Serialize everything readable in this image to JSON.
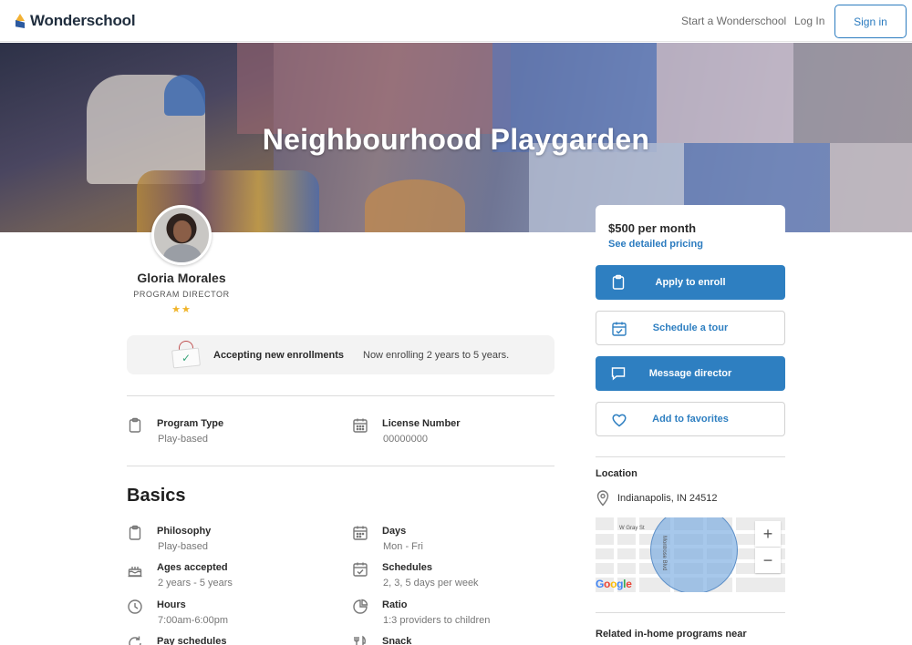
{
  "header": {
    "logo_text": "Wonderschool",
    "start_link": "Start a Wonderschool",
    "login_link": "Log In",
    "signin_button": "Sign in"
  },
  "hero": {
    "title": "Neighbourhood Playgarden"
  },
  "director": {
    "name": "Gloria Morales",
    "role": "PROGRAM DIRECTOR",
    "stars": "★★",
    "rating": 2
  },
  "enrollment": {
    "label": "Accepting new enrollments",
    "description": "Now enrolling 2 years to 5 years."
  },
  "program": {
    "type_title": "Program Type",
    "type_value": "Play-based",
    "license_title": "License Number",
    "license_value": "00000000"
  },
  "basics": {
    "heading": "Basics",
    "items": [
      {
        "title": "Philosophy",
        "value": "Play-based",
        "icon": "clipboard-icon"
      },
      {
        "title": "Days",
        "value": "Mon - Fri",
        "icon": "calendar-icon"
      },
      {
        "title": "Ages accepted",
        "value": "2 years - 5 years",
        "icon": "cake-icon"
      },
      {
        "title": "Schedules",
        "value": "2, 3, 5 days per week",
        "icon": "calendar-check-icon"
      },
      {
        "title": "Hours",
        "value": "7:00am-6:00pm",
        "icon": "clock-icon"
      },
      {
        "title": "Ratio",
        "value": "1:3 providers to children",
        "icon": "pie-chart-icon"
      },
      {
        "title": "Pay schedules",
        "value": "",
        "icon": "refresh-icon"
      },
      {
        "title": "Snack",
        "value": "",
        "icon": "utensils-icon"
      }
    ]
  },
  "sidebar": {
    "price": "$500 per month",
    "pricing_link": "See detailed pricing",
    "apply_button": "Apply to enroll",
    "tour_button": "Schedule a tour",
    "message_button": "Message director",
    "favorites_button": "Add to favorites",
    "location_heading": "Location",
    "location_text": "Indianapolis, IN 24512",
    "related_heading": "Related in-home programs near"
  },
  "map": {
    "street_1": "W Gray St",
    "street_2": "Montrose Blvd",
    "zoom_in": "+",
    "zoom_out": "−",
    "attribution": "Google"
  },
  "colors": {
    "accent": "#2e7fc1",
    "star": "#f0b429",
    "brand_dark": "#1f2d3d"
  }
}
